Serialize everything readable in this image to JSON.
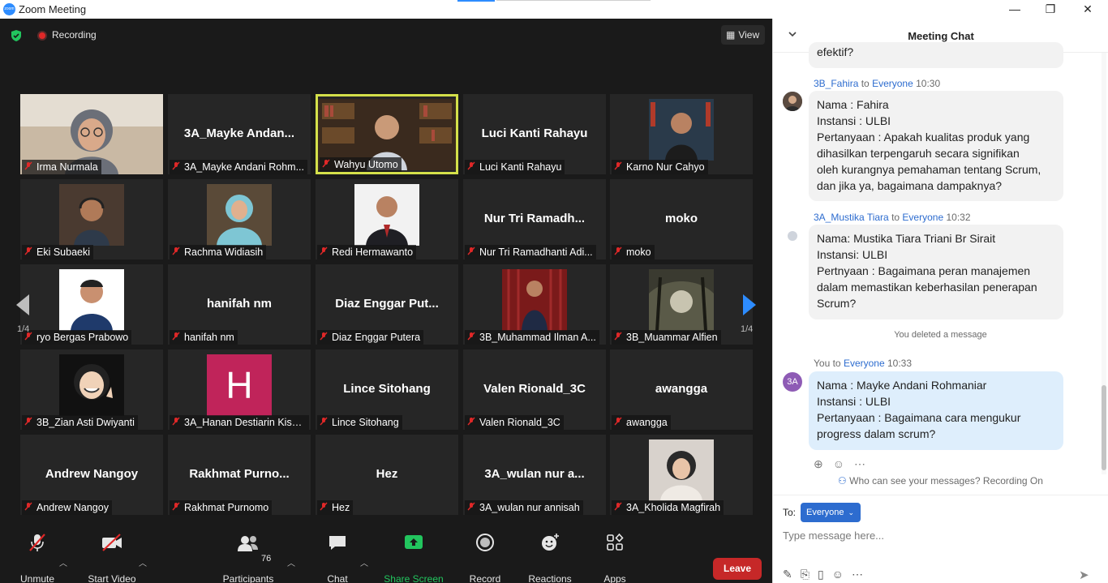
{
  "window": {
    "title": "Zoom Meeting",
    "minimize": "—",
    "restore": "❐",
    "close": "✕"
  },
  "meeting": {
    "recording_label": "Recording",
    "view_label": "View",
    "page_left": "1/4",
    "page_right": "1/4",
    "tiles": [
      {
        "label": "Irma Nurmala",
        "display": "",
        "photo": "hijab-glasses"
      },
      {
        "label": "3A_Mayke Andani Rohm...",
        "display": "3A_Mayke  Andan..."
      },
      {
        "label": "Wahyu Utomo",
        "display": "",
        "photo": "speaker-bookshelf",
        "active": true
      },
      {
        "label": "Luci Kanti Rahayu",
        "display": "Luci Kanti Rahayu"
      },
      {
        "label": "Karno Nur Cahyo",
        "display": "",
        "photo": "man-bookshelf"
      },
      {
        "label": "Eki Subaeki",
        "display": "",
        "photo": "man-headset"
      },
      {
        "label": "Rachma Widiasih",
        "display": "",
        "photo": "woman-hijab-blue"
      },
      {
        "label": "Redi Hermawanto",
        "display": "",
        "photo": "man-suit"
      },
      {
        "label": "Nur Tri Ramadhanti Adi...",
        "display": "Nur Tri Ramadh..."
      },
      {
        "label": "moko",
        "display": "moko"
      },
      {
        "label": "ryo Bergas Prabowo",
        "display": "",
        "photo": "man-smile"
      },
      {
        "label": "hanifah nm",
        "display": "hanifah nm"
      },
      {
        "label": "Diaz Enggar Putera",
        "display": "Diaz  Enggar  Put..."
      },
      {
        "label": "3B_Muhammad Ilman A...",
        "display": "",
        "photo": "man-red-curtain"
      },
      {
        "label": "3B_Muammar Alfien",
        "display": "",
        "photo": "dark-forest"
      },
      {
        "label": "3B_Zian Asti Dwiyanti",
        "display": "",
        "photo": "memoji"
      },
      {
        "label": "3A_Hanan Destiarin Kish...",
        "display": "",
        "photo": "letter-avatar",
        "avatar_letter": "H"
      },
      {
        "label": "Lince Sitohang",
        "display": "Lince Sitohang"
      },
      {
        "label": "Valen Rionald_3C",
        "display": "Valen Rionald_3C"
      },
      {
        "label": "awangga",
        "display": "awangga"
      },
      {
        "label": "Andrew Nangoy",
        "display": "Andrew Nangoy"
      },
      {
        "label": "Rakhmat Purnomo",
        "display": "Rakhmat  Purno..."
      },
      {
        "label": "Hez",
        "display": "Hez"
      },
      {
        "label": "3A_wulan nur annisah",
        "display": "3A_wulan  nur  a..."
      },
      {
        "label": "3A_Kholida Magfirah",
        "display": "",
        "photo": "woman-hijab-pose"
      }
    ]
  },
  "toolbar": {
    "unmute": "Unmute",
    "start_video": "Start Video",
    "participants": "Participants",
    "participants_count": "76",
    "chat": "Chat",
    "share_screen": "Share Screen",
    "record": "Record",
    "reactions": "Reactions",
    "apps": "Apps",
    "leave": "Leave"
  },
  "chat": {
    "title": "Meeting Chat",
    "truncated_top": "efektif?",
    "messages": [
      {
        "sender": "3B_Fahira",
        "to_word": "to",
        "to": "Everyone",
        "time": "10:30",
        "lines": [
          "Nama : Fahira",
          "Instansi : ULBI",
          "Pertanyaan : Apakah kualitas produk yang",
          "dihasilkan terpengaruh secara signifikan",
          "oleh kurangnya pemahaman tentang Scrum,",
          "dan jika ya, bagaimana dampaknya?"
        ]
      },
      {
        "sender": "3A_Mustika Tiara",
        "to_word": "to",
        "to": "Everyone",
        "time": "10:32",
        "lines": [
          "Nama: Mustika Tiara Triani Br Sirait",
          "Instansi: ULBI",
          "Pertnyaan : Bagaimana peran manajemen",
          "dalam memastikan keberhasilan penerapan",
          "Scrum?"
        ]
      },
      {
        "sender": "You",
        "to_word": "to",
        "to": "Everyone",
        "time": "10:33",
        "avatar": "3A",
        "lines": [
          "Nama : Mayke Andani Rohmaniar",
          "Instansi : ULBI",
          "Pertanyaan : Bagaimana cara mengukur",
          "progress dalam scrum?"
        ]
      }
    ],
    "deleted_notice": "You deleted a message",
    "privacy_notice": "Who can see your messages? Recording On",
    "to_label": "To:",
    "recipient": "Everyone",
    "input_placeholder": "Type message here..."
  },
  "colors": {
    "accent_blue": "#2d6ccf",
    "leave_red": "#c62828",
    "active_speaker": "#d4e04a",
    "share_green": "#22c55e",
    "my_bubble": "#deeefc"
  }
}
